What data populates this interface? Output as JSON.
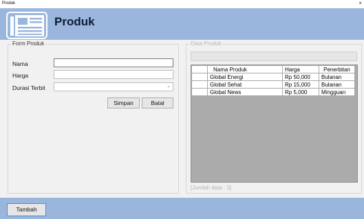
{
  "window": {
    "title": "Produk",
    "close_glyph": "×"
  },
  "header": {
    "title": "Produk",
    "logo_icon": "newspaper-icon",
    "bg_color": "#9ab6dd"
  },
  "form": {
    "legend": "Form Produk",
    "nama_label": "Nama",
    "nama_value": "",
    "harga_label": "Harga",
    "harga_value": "",
    "durasi_label": "Durasi Terbit",
    "durasi_value": "",
    "simpan_label": "Simpan",
    "batal_label": "Batal"
  },
  "data_panel": {
    "legend": "Data Produk",
    "search_value": "",
    "columns": [
      "Nama Produk",
      "Harga",
      "Penerbitan"
    ],
    "rows": [
      [
        "Global Energi",
        "Rp 50,000",
        "Bulanan"
      ],
      [
        "Global Sehat",
        "Rp 15,000",
        "Bulanan"
      ],
      [
        "Global News",
        "Rp 5,000",
        "Mingguan"
      ]
    ],
    "count_label": "[Jumlah data : 3]"
  },
  "footer": {
    "tambah_label": "Tambah"
  }
}
